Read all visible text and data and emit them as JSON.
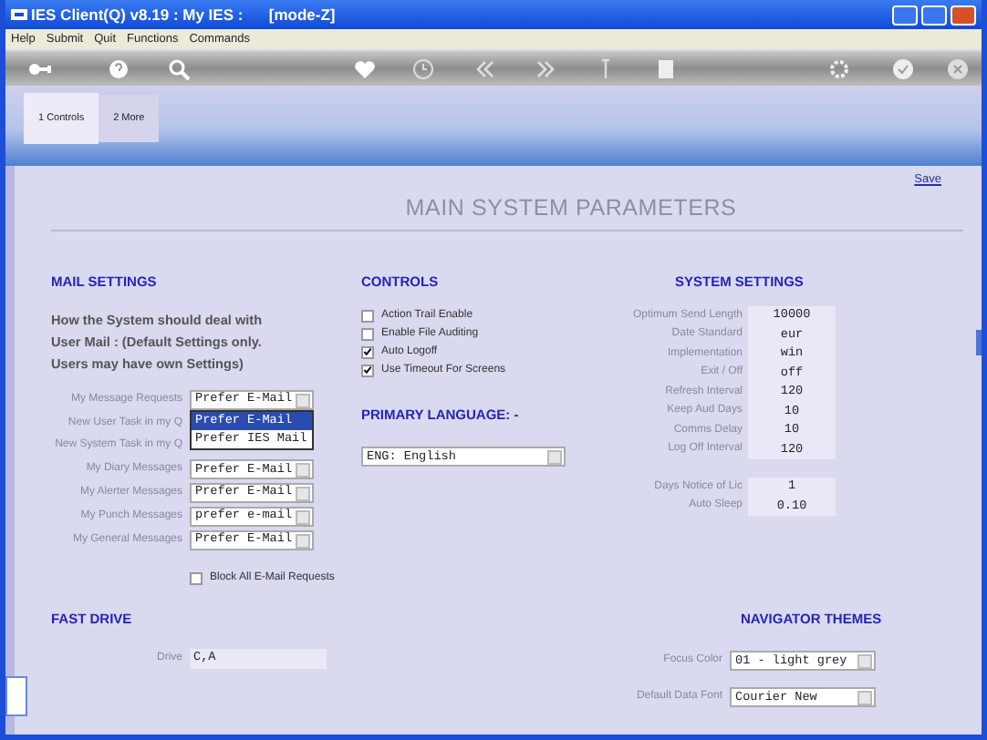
{
  "window": {
    "title": "IES Client(Q) v8.19 : My IES :      [mode-Z]"
  },
  "menu": [
    "Help",
    "Submit",
    "Quit",
    "Functions",
    "Commands"
  ],
  "tabs": [
    {
      "label": "1 Controls",
      "selected": true
    },
    {
      "label": "2 More",
      "selected": false
    }
  ],
  "page": {
    "title": "MAIN SYSTEM PARAMETERS",
    "save_link": "Save"
  },
  "mail_settings": {
    "heading": "MAIL SETTINGS",
    "description": [
      "How the System should deal with",
      "User Mail : (Default Settings only.",
      "Users may have own Settings)"
    ],
    "fields": [
      {
        "label": "My Message Requests",
        "value": "Prefer E-Mail",
        "options": [
          {
            "label": "Prefer E-Mail",
            "selected": true
          },
          {
            "label": "Prefer IES Mail",
            "selected": false
          }
        ]
      },
      {
        "label": "New User Task in my Q"
      },
      {
        "label": "New System Task in my Q"
      },
      {
        "label": "My Diary Messages",
        "value": "Prefer E-Mail"
      },
      {
        "label": "My Alerter Messages",
        "value": "Prefer E-Mail"
      },
      {
        "label": "My Punch Messages",
        "value": "prefer e-mail"
      },
      {
        "label": "My General Messages",
        "value": "Prefer E-Mail"
      }
    ],
    "block_all": {
      "label": "Block All E-Mail Requests",
      "checked": false
    }
  },
  "controls": {
    "heading": "CONTROLS",
    "options": [
      {
        "label": "Action Trail Enable",
        "checked": false
      },
      {
        "label": "Enable File Auditing",
        "checked": false
      },
      {
        "label": "Auto Logoff",
        "checked": true
      },
      {
        "label": "Use Timeout For Screens",
        "checked": true
      }
    ]
  },
  "primary_language": {
    "heading": "PRIMARY LANGUAGE: -",
    "value": "ENG: English"
  },
  "system_settings": {
    "heading": "SYSTEM SETTINGS",
    "groups": [
      [
        {
          "label": "Optimum Send Length",
          "value": "10000"
        },
        {
          "label": "Date Standard",
          "value": "eur"
        },
        {
          "label": "Implementation",
          "value": "win"
        },
        {
          "label": "Exit / Off",
          "value": "off"
        },
        {
          "label": "Refresh Interval",
          "value": "120"
        },
        {
          "label": "Keep Aud Days",
          "value": "10"
        },
        {
          "label": "Comms Delay",
          "value": "10"
        },
        {
          "label": "Log Off Interval",
          "value": "120"
        }
      ],
      [
        {
          "label": "Days Notice of Lic",
          "value": "1"
        },
        {
          "label": "Auto Sleep",
          "value": "0.10"
        }
      ]
    ]
  },
  "fast_drive": {
    "heading": "FAST DRIVE",
    "label": "Drive",
    "value": "C,A"
  },
  "navigator_themes": {
    "heading": "NAVIGATOR THEMES",
    "fields": [
      {
        "label": "Focus Color",
        "value": "01 - light grey"
      },
      {
        "label": "Default Data Font",
        "value": "Courier New"
      }
    ]
  }
}
